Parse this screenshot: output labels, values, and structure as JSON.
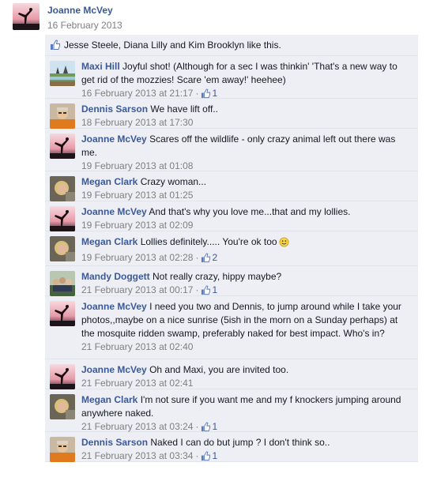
{
  "post": {
    "author": "Joanne McVey",
    "date": "16 February 2013"
  },
  "likes": {
    "text": "Jesse Steele, Diana Lilly and Kim Brooklyn like this."
  },
  "comments": [
    {
      "author": "Maxi Hill",
      "text": "Joyful shot! (Although for a sec I was thinkin' 'That's a new way to get rid of the mozzies! Scare 'em away!' heehee)",
      "time": "16 February 2013 at 21:17",
      "likes": "1",
      "avatar": "landscape"
    },
    {
      "author": "Dennis Sarson",
      "text": "We have lift off..",
      "time": "18 February 2013 at 17:30",
      "likes": "",
      "avatar": "person-orange"
    },
    {
      "author": "Joanne McVey",
      "text": "Scares off the wildlife - only crazy animal left out there was me.",
      "time": "19 February 2013 at 01:08",
      "likes": "",
      "avatar": "sunset"
    },
    {
      "author": "Megan Clark",
      "text": "Crazy woman...",
      "time": "19 February 2013 at 01:25",
      "likes": "",
      "avatar": "person-blonde"
    },
    {
      "author": "Joanne McVey",
      "text": "And that's why you love me...that and my lollies.",
      "time": "19 February 2013 at 02:09",
      "likes": "",
      "avatar": "sunset"
    },
    {
      "author": "Megan Clark",
      "text": "Lollies definitely..... You're ok too",
      "time": "19 February 2013 at 02:28",
      "likes": "2",
      "avatar": "person-blonde",
      "smiley": true
    },
    {
      "author": "Mandy Doggett",
      "text": "Not really crazy, hippy maybe?",
      "time": "21 February 2013 at 00:17",
      "likes": "1",
      "avatar": "group"
    },
    {
      "author": "Joanne McVey",
      "text": "I need you two and Dennis, to jump around while I take your photos,,maybe on a nice sunrise (5ish in the morn on a Sunday perhaps) at the mosquite ridden swamp, preferably naked for best impact. Who's in?",
      "time": "21 February 2013 at 02:40",
      "likes": "",
      "avatar": "sunset"
    },
    {
      "author": "Joanne McVey",
      "text": "Oh and Maxi, you are invited too.",
      "time": "21 February 2013 at 02:41",
      "likes": "",
      "avatar": "sunset"
    },
    {
      "author": "Megan Clark",
      "text": "I'm not sure if you want me and my f knockers jumping around anywhere naked.",
      "time": "21 February 2013 at 03:24",
      "likes": "1",
      "avatar": "person-blonde"
    },
    {
      "author": "Dennis Sarson",
      "text": "Naked I can do but jump ? I don't think so..",
      "time": "21 February 2013 at 03:34",
      "likes": "1",
      "avatar": "person-orange"
    }
  ],
  "colors": {
    "link": "#3b5998",
    "meta": "#7f7f7f",
    "panel": "#edeff4"
  }
}
